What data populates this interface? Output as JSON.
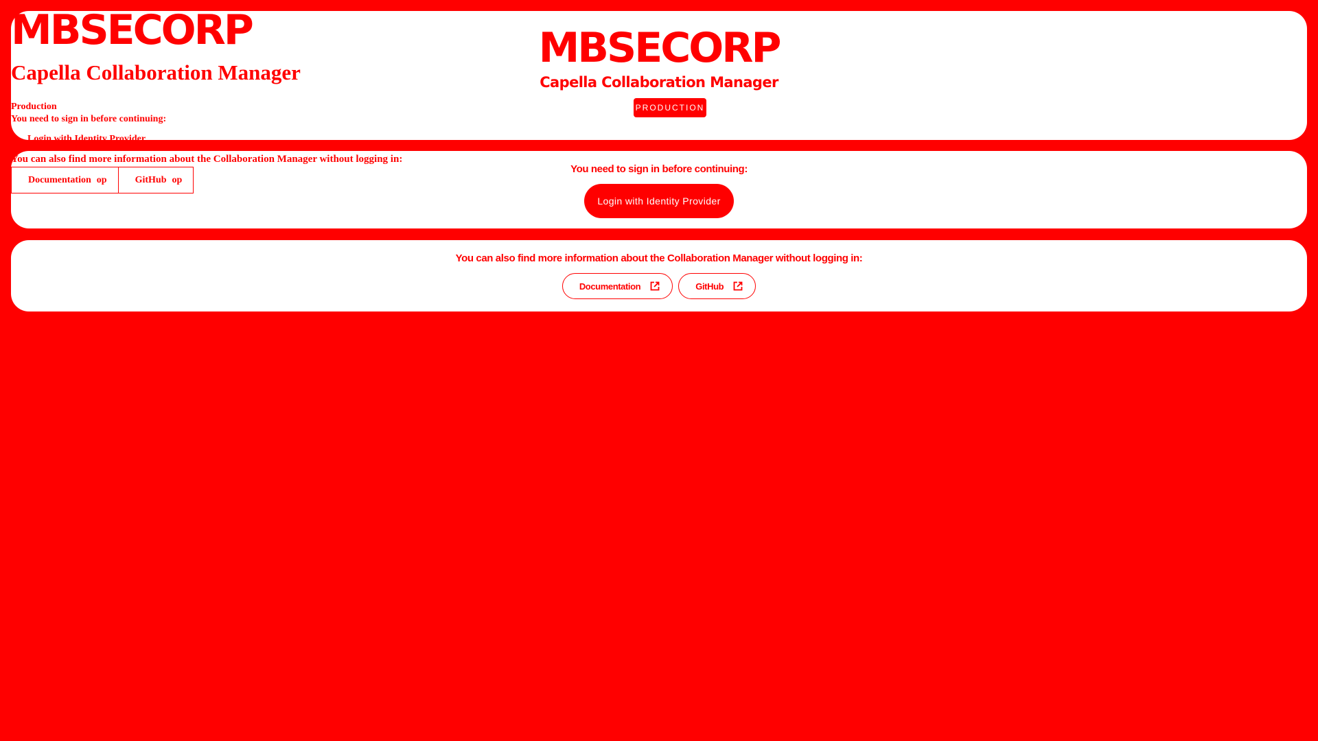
{
  "brand": {
    "logo": "MBSECORP",
    "app_title": "Capella Collaboration Manager",
    "environment_badge": "PRODUCTION",
    "environment_text": "Production"
  },
  "login": {
    "prompt": "You need to sign in before continuing:",
    "button_label": "Login with Identity Provider"
  },
  "info": {
    "text": "You can also find more information about the Collaboration Manager without logging in:",
    "links": [
      {
        "label": "Documentation",
        "icon": "open-in-new-icon",
        "raw_icon_text": "op"
      },
      {
        "label": "GitHub",
        "icon": "open-in-new-icon",
        "raw_icon_text": "op"
      }
    ]
  },
  "colors": {
    "background": "#ff0000",
    "card": "#ffffff",
    "accent": "#ff0000",
    "on_accent": "#ffffff"
  }
}
